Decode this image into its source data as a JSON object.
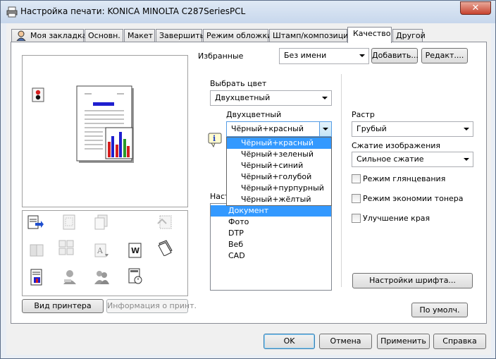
{
  "window": {
    "title": "Настройка печати: KONICA MINOLTA C287SeriesPCL",
    "close_glyph": "✕"
  },
  "tabs": [
    "Моя закладка",
    "Основн.",
    "Макет",
    "Завершить",
    "Режим обложки",
    "Штамп/композиция",
    "Качество",
    "Другой"
  ],
  "favorites": {
    "label": "Избранные",
    "value": "Без имени",
    "add_label": "Добавить...",
    "edit_label": "Редакт...."
  },
  "color": {
    "label": "Выбрать цвет",
    "value": "Двухцветный",
    "two_color_label": "Двухцветный",
    "two_color_value": "Чёрный+красный",
    "options": [
      "Чёрный+красный",
      "Чёрный+зеленый",
      "Чёрный+синий",
      "Чёрный+голубой",
      "Чёрный+пурпурный",
      "Чёрный+жёлтый"
    ]
  },
  "doc_type": {
    "label_visible": "Наст",
    "items": [
      "Документ",
      "Фото",
      "DTP",
      "Веб",
      "CAD"
    ]
  },
  "raster": {
    "label": "Растр",
    "value": "Грубый"
  },
  "compression": {
    "label": "Сжатие изображения",
    "value": "Сильное сжатие"
  },
  "checks": {
    "gloss": "Режим глянцевания",
    "toner_save": "Режим экономии тонера",
    "edge": "Улучшение края"
  },
  "buttons": {
    "font_settings": "Настройки шрифта...",
    "defaults": "По умолч.",
    "printer_view": "Вид принтера",
    "printer_info": "Информация о принт.",
    "ok": "OK",
    "cancel": "Отмена",
    "apply": "Применить",
    "help": "Справка"
  },
  "colors": {
    "accent": "#3399ff",
    "chart_blue": "#1f1fcf",
    "chart_red": "#d61f1f",
    "chart_green": "#2a9a2a"
  }
}
